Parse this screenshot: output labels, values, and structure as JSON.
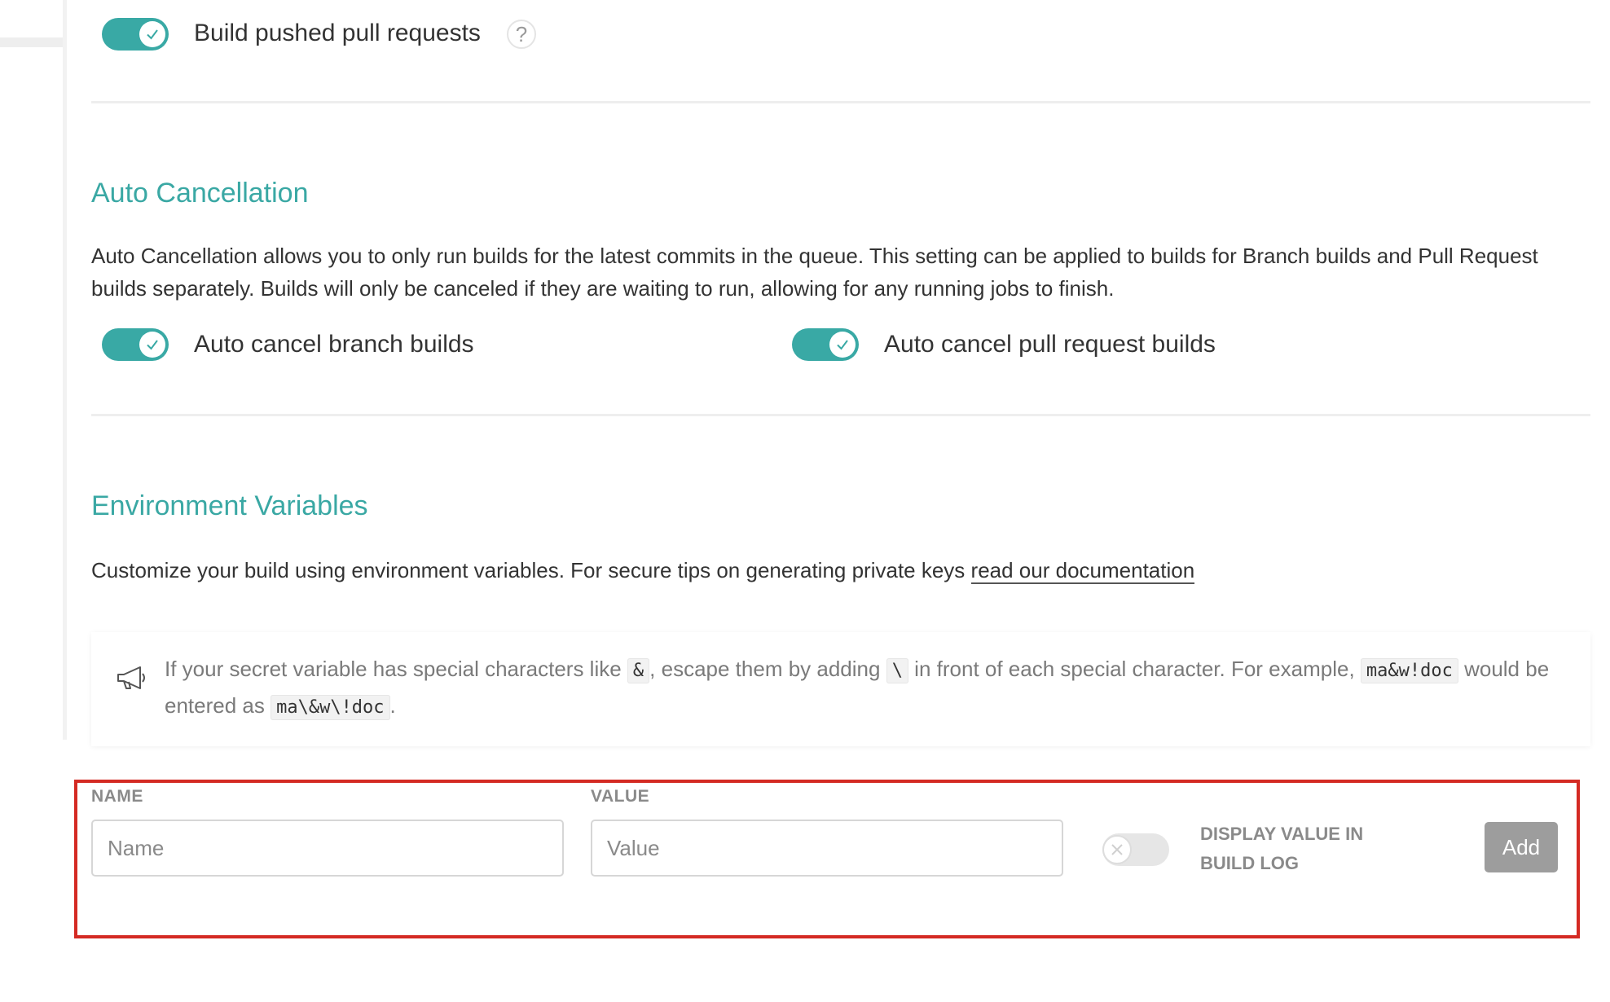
{
  "pull_requests": {
    "build_pushed_pull_requests": {
      "label": "Build pushed pull requests",
      "enabled": true,
      "help_icon": "question-mark-icon"
    }
  },
  "auto_cancellation": {
    "title": "Auto Cancellation",
    "description": "Auto Cancellation allows you to only run builds for the latest commits in the queue. This setting can be applied to builds for Branch builds and Pull Request builds separately. Builds will only be canceled if they are waiting to run, allowing for any running jobs to finish.",
    "branch_toggle": {
      "label": "Auto cancel branch builds",
      "enabled": true
    },
    "pr_toggle": {
      "label": "Auto cancel pull request builds",
      "enabled": true
    }
  },
  "environment_variables": {
    "title": "Environment Variables",
    "description_prefix": "Customize your build using environment variables. For secure tips on generating private keys ",
    "doc_link": "read our documentation",
    "notice": {
      "icon": "megaphone-icon",
      "part1": "If your secret variable has special characters like ",
      "code1": "&",
      "part2": ", escape them by adding ",
      "code2": "\\",
      "part3": " in front of each special character. For example, ",
      "code3": "ma&w!doc",
      "part4": " would be entered as ",
      "code4": "ma\\&w\\!doc",
      "part5": "."
    },
    "form": {
      "name_label": "NAME",
      "name_placeholder": "Name",
      "value_label": "VALUE",
      "value_placeholder": "Value",
      "display_toggle": {
        "enabled": false
      },
      "display_label": "DISPLAY VALUE IN BUILD LOG",
      "add_label": "Add"
    }
  },
  "colors": {
    "accent": "#39a9a5",
    "highlight_border": "#d42a23",
    "button_disabled": "#9d9d9d"
  }
}
